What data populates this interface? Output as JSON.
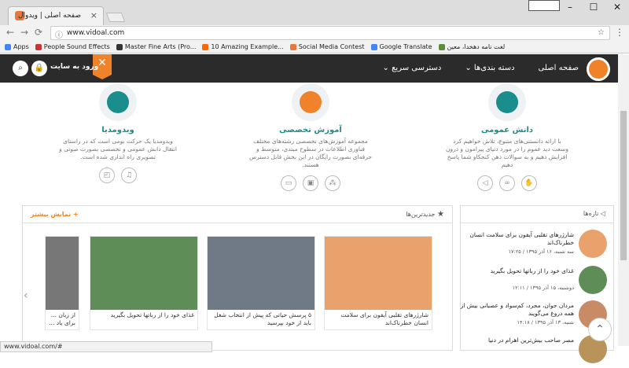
{
  "browser": {
    "tab_title": "صفحه اصلی | ویدوال",
    "url": "www.vidoal.com",
    "bookmarks": [
      {
        "label": "Apps",
        "color": "#4285f4"
      },
      {
        "label": "People Sound Effects",
        "color": "#cc3333"
      },
      {
        "label": "Master Fine Arts (Pro...",
        "color": "#333333"
      },
      {
        "label": "10 Amazing Example...",
        "color": "#ff6600"
      },
      {
        "label": "Social Media Contest",
        "color": "#e8793b"
      },
      {
        "label": "Google Translate",
        "color": "#4285f4"
      },
      {
        "label": "لغت نامه دهخدا، معین",
        "color": "#5a8f3a"
      }
    ],
    "status_url": "www.vidoal.com/#"
  },
  "header": {
    "nav": [
      "صفحه اصلی",
      "دسته بندی‌ها ⌄",
      "دسترسی سریع ⌄"
    ],
    "close_glyph": "✕",
    "login": "ورود به سایت",
    "lock_glyph": "🔒",
    "search_glyph": "⌕"
  },
  "features": [
    {
      "title": "دانش عمومی",
      "desc": "با ارائه دانستنی‌های متنوع، تلاش خواهیم کرد وسعت دید عموم را در مورد دنیای پیرامون و درون افزایش دهیم و به سوالات ذهن کنجکاو شما پاسخ دهیم"
    },
    {
      "title": "آموزش تخصصی",
      "desc": "مجموعه آموزش‌های تخصصی رشته‌های مختلف فناوری اطلاعات در سطوح مبتدی، متوسط و حرفه‌ای بصورت رایگان در این بخش قابل دسترس هستند."
    },
    {
      "title": "ویدومدیا",
      "desc": "ویدومدیا یک حرکت بومی است که در راستای انتقال دانش عمومی و تخصصی بصورت صوتی و تصویری راه اندازی شده است."
    }
  ],
  "newest": {
    "title": "جدیدترین‌ها",
    "more": "+ نمایش بیشتر",
    "cards": [
      {
        "title": "شارژرهای تقلبی آیفون برای سلامت انسان خطرناک‌اند"
      },
      {
        "title": "۵ پرسش حیاتی که پیش از انتخاب شغل باید از خود بپرسید"
      },
      {
        "title": "غذای خود را از رباتها تحویل بگیرید"
      },
      {
        "title": "از زبان ... برای یاد ..."
      }
    ]
  },
  "news": {
    "title": "تازه‌ها",
    "items": [
      {
        "title": "شارژرهای تقلبی آیفون برای سلامت انسان خطرناک‌اند",
        "date": "سه شنبه، ۱۶ آذر ۱۳۹۵ / ۱۷:۲۵"
      },
      {
        "title": "غذای خود را از رباتها تحویل بگیرید",
        "date": "دوشنبه، ۱۵ آذر ۱۳۹۵ / ۱۲:۱۱"
      },
      {
        "title": "مردان جوان، مجرد، کم‌سواد و عصبانی بیش از همه دروغ می‌گویند",
        "date": "شنبه، ۱۳ آذر ۱۳۹۵ / ۱۴:۱۸"
      },
      {
        "title": "مصر صاحب بیش‌ترین اهرام در دنیا",
        "date": ""
      }
    ]
  },
  "colors": {
    "accent": "#f0822a",
    "teal": "#1a8d8d",
    "header": "#2b2b2b"
  }
}
